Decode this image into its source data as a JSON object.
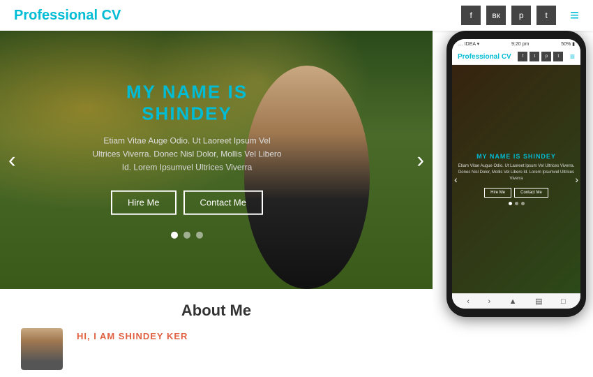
{
  "header": {
    "logo_text": "Professional ",
    "logo_bold": "CV",
    "social_icons": [
      "f",
      "vk",
      "p",
      "t"
    ]
  },
  "hero": {
    "title_prefix": "MY NAME IS ",
    "title_highlight": "SHINDEY",
    "description": "Etiam Vitae Auge Odio. Ut Laoreet Ipsum Vel Ultrices Viverra. Donec Nisl Dolor, Mollis Vel Libero Id. Lorem Ipsumvel Ultrices Viverra",
    "btn_hire": "Hire Me",
    "btn_contact": "Contact Me",
    "dots": [
      true,
      false,
      false
    ]
  },
  "phone": {
    "status": "IDEA ▾  9:20 pm  50%",
    "logo_text": "Professional ",
    "logo_bold": "CV",
    "title_prefix": "MY NAME IS ",
    "title_highlight": "SHINDEY",
    "description": "Etiam Vitae Augue Odio. Ut Laoreet Ipsum Vel Ultrices Viverra. Donec Nisl Dolor, Mollis Vel Libero Id. Lorem Ipsumvel Ultrices Viverra",
    "btn_hire": "Hire Me",
    "btn_contact": "Contact Me"
  },
  "about": {
    "title": "About Me",
    "subtitle": "HI, I AM SHINDEY KER"
  }
}
